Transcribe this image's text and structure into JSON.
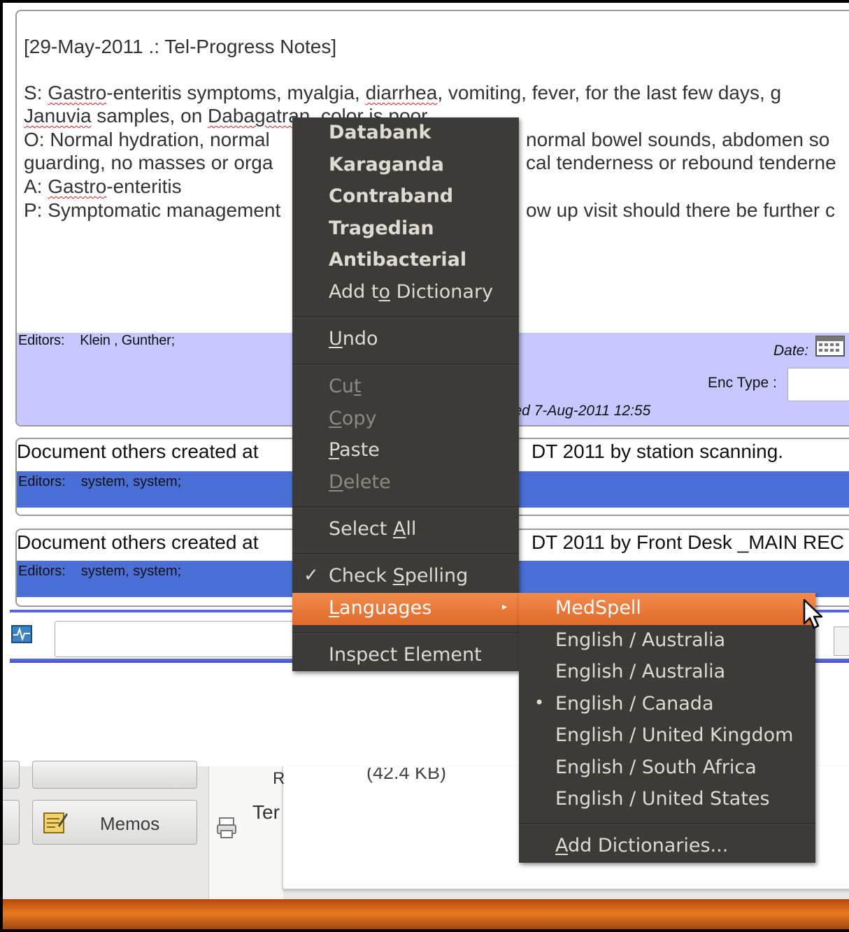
{
  "note": {
    "title": "[29-May-2011 .: Tel-Progress Notes]",
    "s_prefix": "S: ",
    "s_word1": "Gastro",
    "s_mid1": "-enteritis symptoms, myalgia, ",
    "s_word2": "diarrhea",
    "s_rest": ", vomiting, fever, for the last few days, g",
    "line2_word1": "Januvia",
    "line2_mid": " samples, on ",
    "line2_word2": "Dabagatran",
    "line2_rest": ", color is poor",
    "line3_left": "O: Normal hydration, normal",
    "line3_right": "normal bowel sounds, abdomen so",
    "line4_left": "guarding, no masses or orga",
    "line4_right": "cal tenderness or rebound tenderne",
    "line5_prefix": "A: ",
    "line5_word": "Gastro",
    "line5_rest": "-enteritis",
    "line6_left": "P: Symptomatic management",
    "line6_right": "ow up visit should there be further c",
    "editors_label": "Editors:",
    "editors_value": "Klein , Gunther;",
    "date_label": "Date:",
    "enc_type_label": "Enc Type :",
    "saved_text": "ved 7-Aug-2011 12:55"
  },
  "docs": [
    {
      "title_left": "Document others created at",
      "title_right": "DT 2011 by station scanning.",
      "editors_label": "Editors:",
      "editors_value": "system, system;"
    },
    {
      "title_left": "Document others created at",
      "title_right": "DT 2011 by Front Desk _MAIN REC",
      "editors_label": "Editors:",
      "editors_value": "system, system;"
    }
  ],
  "context_menu": {
    "suggestions": [
      "Databank",
      "Karaganda",
      "Contraband",
      "Tragedian",
      "Antibacterial"
    ],
    "add_to_dictionary": [
      "Add t",
      "o",
      " Dictionary"
    ],
    "undo": [
      "",
      "U",
      "ndo"
    ],
    "cut": [
      "Cu",
      "t",
      ""
    ],
    "copy": [
      "",
      "C",
      "opy"
    ],
    "paste": [
      "",
      "P",
      "aste"
    ],
    "delete": [
      "",
      "D",
      "elete"
    ],
    "select_all": [
      "Select ",
      "A",
      "ll"
    ],
    "check_spelling": [
      "Check ",
      "S",
      "pelling"
    ],
    "check_mark": "✓",
    "languages": [
      "",
      "L",
      "anguages"
    ],
    "submenu_arrow": "▸",
    "inspect_element": "Inspect Element"
  },
  "languages_submenu": {
    "items": [
      "MedSpell",
      "English / Australia",
      "English / Australia",
      "English / Canada",
      "English / United Kingdom",
      "English / South Africa",
      "English / United States"
    ],
    "selected_bullet": "•",
    "add_dictionaries": [
      "",
      "A",
      "dd Dictionaries..."
    ]
  },
  "background": {
    "memos_label": "Memos",
    "ter_fragment": "Ter",
    "size_fragment": "(42.4 KB)",
    "r_fragment": "R"
  }
}
